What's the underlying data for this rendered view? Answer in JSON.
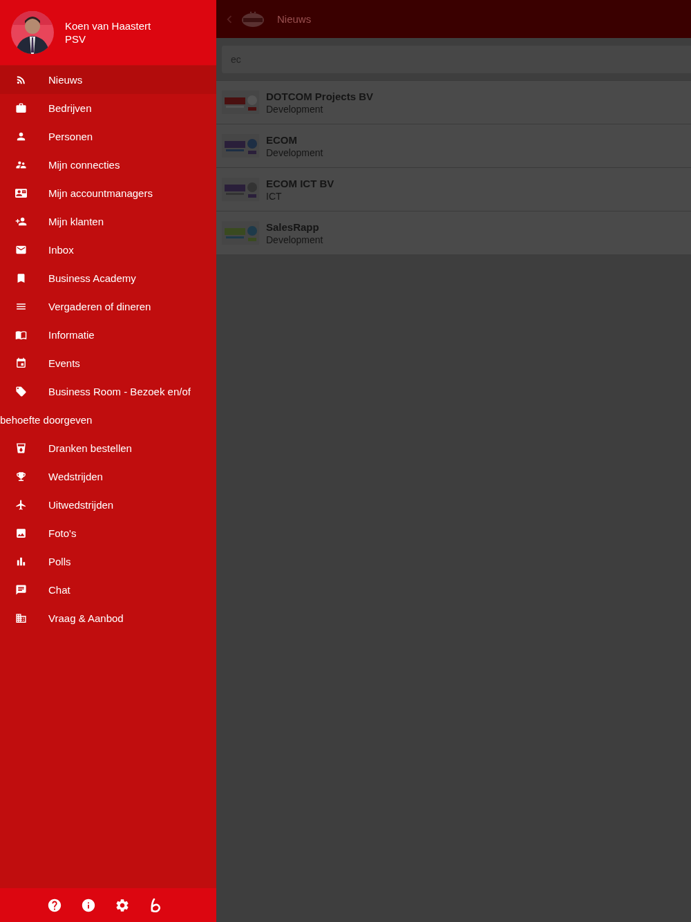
{
  "drawer": {
    "user": {
      "name": "Koen van Haastert",
      "club": "PSV"
    },
    "items": [
      {
        "label": "Nieuws",
        "selected": true
      },
      {
        "label": "Bedrijven",
        "selected": false
      },
      {
        "label": "Personen",
        "selected": false
      },
      {
        "label": "Mijn connecties",
        "selected": false
      },
      {
        "label": "Mijn accountmanagers",
        "selected": false
      },
      {
        "label": "Mijn klanten",
        "selected": false
      },
      {
        "label": "Inbox",
        "selected": false
      },
      {
        "label": "Business Academy",
        "selected": false
      },
      {
        "label": "Vergaderen of dineren",
        "selected": false
      },
      {
        "label": "Informatie",
        "selected": false
      },
      {
        "label": "Events",
        "selected": false
      },
      {
        "label": "Business Room - Bezoek en/of behoefte doorgeven",
        "selected": false
      },
      {
        "label": "Dranken bestellen",
        "selected": false
      },
      {
        "label": "Wedstrijden",
        "selected": false
      },
      {
        "label": "Uitwedstrijden",
        "selected": false
      },
      {
        "label": "Foto's",
        "selected": false
      },
      {
        "label": "Polls",
        "selected": false
      },
      {
        "label": "Chat",
        "selected": false
      },
      {
        "label": "Vraag & Aanbod",
        "selected": false
      }
    ]
  },
  "app_bar": {
    "title": "Nieuws"
  },
  "search": {
    "value": "ec"
  },
  "results": [
    {
      "name": "DOTCOM Projects BV",
      "sector": "Development"
    },
    {
      "name": "ECOM",
      "sector": "Development"
    },
    {
      "name": "ECOM ICT BV",
      "sector": "ICT"
    },
    {
      "name": "SalesRapp",
      "sector": "Development"
    }
  ]
}
